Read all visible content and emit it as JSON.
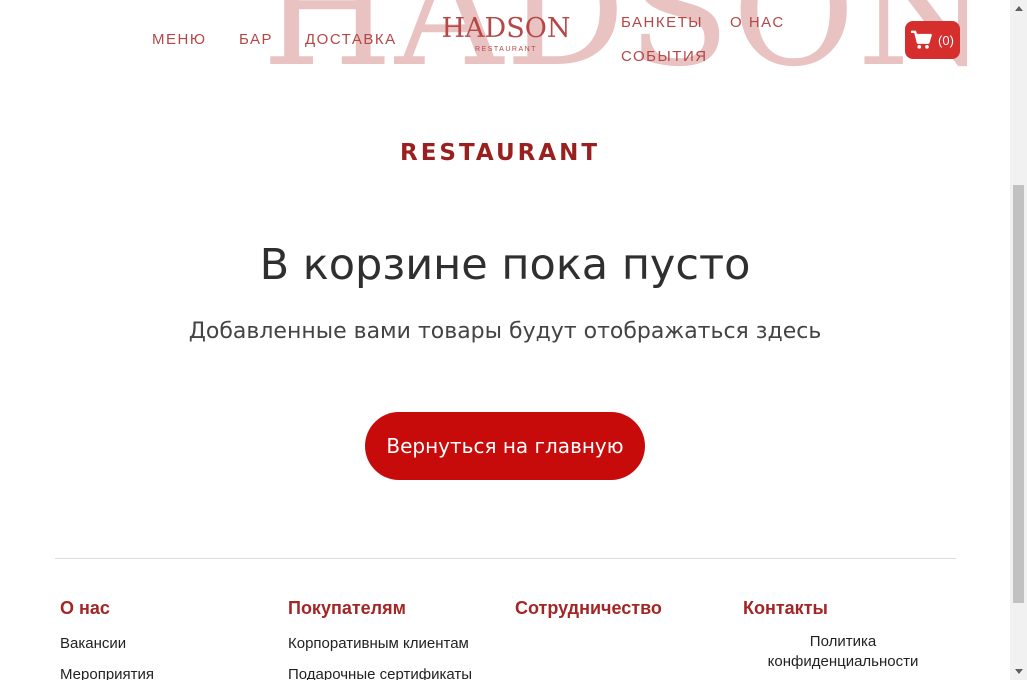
{
  "brand": {
    "hero_name": "HADSON",
    "hero_subtitle": "RESTAURANT",
    "logo_title": "HADSON",
    "logo_subtitle": "RESTAURANT"
  },
  "nav": {
    "menu": "МЕНЮ",
    "bar": "БАР",
    "delivery": "ДОСТАВКА",
    "banquets": "БАНКЕТЫ",
    "about": "О НАС",
    "events": "СОБЫТИЯ"
  },
  "cart": {
    "count": "(0)",
    "icon": "cart-icon",
    "color": "#d62d2d"
  },
  "main": {
    "title": "В корзине пока пусто",
    "subtitle": "Добавленные вами товары будут отображаться здесь",
    "back_button": "Вернуться на главную",
    "accent_color": "#c70b0b"
  },
  "footer": {
    "about_head": "О нас",
    "buyers_head": "Покупателям",
    "coop_head": "Сотрудничество",
    "contacts_head": "Контакты",
    "vacancies": "Вакансии",
    "events": "Мероприятия",
    "corporate": "Корпоративным клиентам",
    "gift_cards": "Подарочные сертификаты",
    "policy": "Политика конфиденциальности"
  }
}
